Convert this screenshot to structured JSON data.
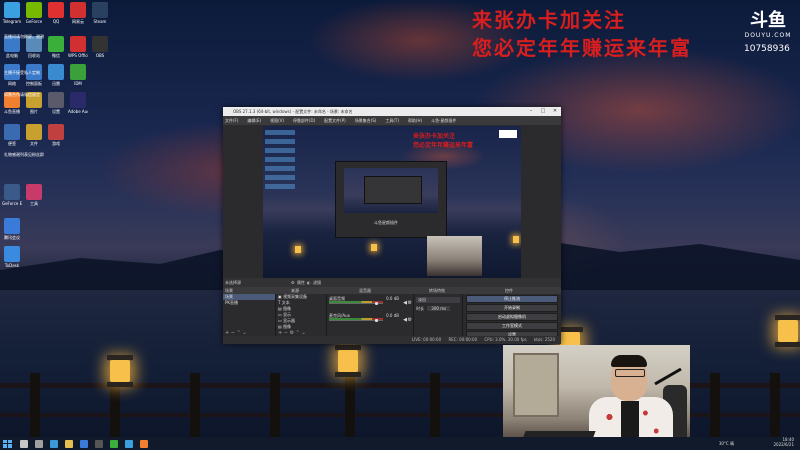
{
  "overlay": {
    "red_line1": "来张办卡加关注",
    "red_line2": "您必定年年赚运来年富",
    "douyu_mark": "斗鱼",
    "douyu_en": "DOUYU.COM",
    "room_id": "10758936"
  },
  "desktop": {
    "icons": [
      {
        "label": "Telegram",
        "color": "#3aa0e0"
      },
      {
        "label": "GeForce",
        "color": "#76b900"
      },
      {
        "label": "QQ",
        "color": "#e03030"
      },
      {
        "label": "网易云",
        "color": "#d03030"
      },
      {
        "label": "Steam",
        "color": "#2a4060"
      },
      {
        "label": "此电脑",
        "color": "#3a7ac8"
      },
      {
        "label": "回收站",
        "color": "#5a8ab8"
      },
      {
        "label": "微信",
        "color": "#3ab03a"
      },
      {
        "label": "WPS Office",
        "color": "#d03030"
      },
      {
        "label": "OBS",
        "color": "#333333"
      },
      {
        "label": "网络",
        "color": "#3a7ac8"
      },
      {
        "label": "控制面板",
        "color": "#3a7ac8"
      },
      {
        "label": "迅雷",
        "color": "#3a8ad0"
      },
      {
        "label": "IDM",
        "color": "#3aa03a"
      },
      {
        "label": "斗鱼直播",
        "color": "#f08030"
      },
      {
        "label": "图片",
        "color": "#c8a030"
      },
      {
        "label": "设置",
        "color": "#5a5a6a"
      },
      {
        "label": "Adobe Audition",
        "color": "#2a2a6a"
      },
      {
        "label": "便签",
        "color": "#3a6ab0"
      },
      {
        "label": "文件",
        "color": "#c8a030"
      },
      {
        "label": "游戏",
        "color": "#c04040"
      },
      {
        "label": "GeForce Experience",
        "color": "#3a5a8a"
      },
      {
        "label": "工具",
        "color": "#c83a6a"
      },
      {
        "label": "腾讯会议",
        "color": "#3a7ad8"
      },
      {
        "label": "ToDesk",
        "color": "#3a8ae0"
      }
    ],
    "notes": [
      "直播间请勿刷屏，谢谢",
      "主播不接受私人定制",
      "如需合作请私信留言",
      "礼物感谢列表见粉丝群"
    ]
  },
  "obs": {
    "title": "OBS 27.1.3 (64-bit, windows) - 配置文件: 未命名 - 场景: 未命名",
    "menu": [
      "文件(F)",
      "编辑(E)",
      "视图(V)",
      "停靠部件(D)",
      "配置文件(P)",
      "场景集合(S)",
      "工具(T)",
      "帮助(H)",
      "斗鱼·星颜插件"
    ],
    "preview_text1": "来张办卡加关注",
    "preview_text2": "您必定年年赚运来年富",
    "preview_nested_label": "斗鱼星颜插件",
    "bar_label": "未选择源",
    "bar_items": [
      "属性",
      "滤镜"
    ],
    "dock_headers": [
      "场景",
      "来源",
      "混音器",
      "转场特效",
      "控件"
    ],
    "scenes": [
      "场景",
      "PK直播"
    ],
    "sources": [
      "视频采集设备",
      "文本",
      "图像",
      "显示",
      "显示器",
      "图像",
      "斗鱼直播"
    ],
    "mixer": [
      {
        "name": "桌面音频",
        "db": "0.0 dB"
      },
      {
        "name": "麦克风/Aux",
        "db": "0.0 dB"
      }
    ],
    "transition": {
      "type": "淡出",
      "duration_label": "时长",
      "duration": "300 ms"
    },
    "controls": [
      "停止推流",
      "开始录制",
      "启动虚拟摄像机",
      "工作室模式",
      "设置",
      "退出"
    ],
    "status": [
      "LIVE: 00:00:00",
      "REC: 00:00:00",
      "CPU: 3.0%, 30.00 fps",
      "kb/s: 2520"
    ]
  },
  "taskbar": {
    "tray_temp": "30°C 晴",
    "tray_time": "18:40",
    "tray_date": "2022/6/21",
    "apps": [
      {
        "name": "search",
        "color": "#c8c8c8"
      },
      {
        "name": "taskview",
        "color": "#a0a0a0"
      },
      {
        "name": "edge",
        "color": "#3a9ad8"
      },
      {
        "name": "explorer",
        "color": "#e8c050"
      },
      {
        "name": "store",
        "color": "#3a7ad8"
      },
      {
        "name": "obs",
        "color": "#555555"
      },
      {
        "name": "wechat",
        "color": "#3ab03a"
      },
      {
        "name": "qq",
        "color": "#3aa0e0"
      },
      {
        "name": "douyu",
        "color": "#f08030"
      }
    ]
  },
  "colors": {
    "overlay_red": "#d81e1e",
    "obs_bg": "#2b2b2e",
    "selected": "#4a5a78"
  }
}
